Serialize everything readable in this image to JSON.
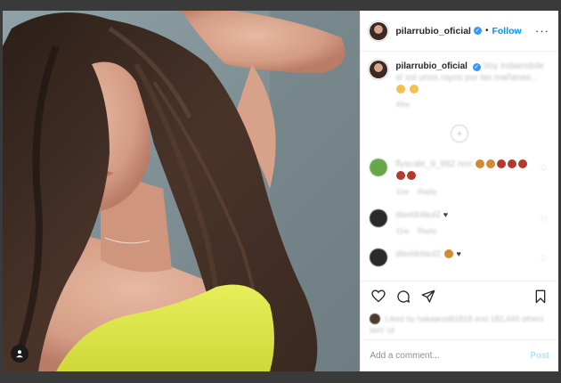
{
  "header": {
    "username": "pilarrubio_oficial",
    "separator": "•",
    "follow_label": "Follow",
    "more_label": "···"
  },
  "caption": {
    "username": "pilarrubio_oficial",
    "text": "Voy indaendole el sol unos rayos por las mañanas...",
    "time": "49w"
  },
  "comments": [
    {
      "username": "flyscale_9_992",
      "text": "nnn",
      "time": "11w",
      "reply_label": "Reply",
      "avatar_color": "#67a74a"
    },
    {
      "username": "davidolaul2",
      "text": "",
      "time": "11w",
      "reply_label": "Reply",
      "avatar_color": "#2a2a2a"
    },
    {
      "username": "davidolaul2",
      "text": "",
      "time": "",
      "reply_label": "",
      "avatar_color": "#2a2a2a"
    }
  ],
  "likes": {
    "text": "Liked by hakaarodit1818 and 182,449 others"
  },
  "date": {
    "text": "MAY 18"
  },
  "add_comment": {
    "placeholder": "Add a comment...",
    "post_label": "Post"
  },
  "icons": {
    "verified": "verified-badge-icon",
    "heart": "heart-icon",
    "comment": "comment-icon",
    "share": "share-icon",
    "save": "bookmark-icon",
    "tag": "user-tag-icon",
    "load_more": "plus-circle-icon"
  },
  "colors": {
    "link_blue": "#0095f6",
    "post_disabled": "#b2dffc",
    "border": "#efefef",
    "text": "#262626",
    "muted": "#8e8e8e"
  }
}
